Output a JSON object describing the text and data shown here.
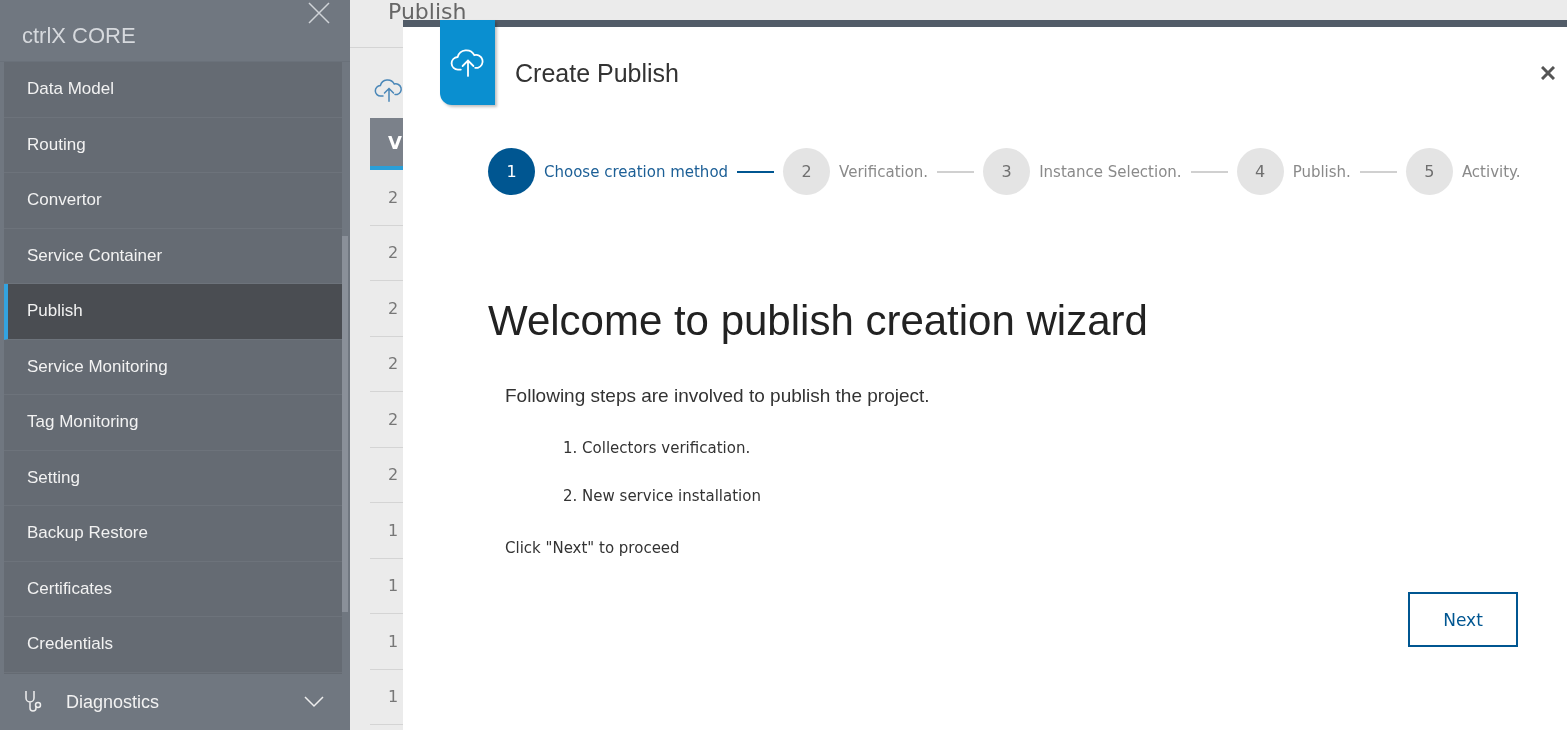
{
  "sidebar": {
    "title": "ctrlX CORE",
    "items": [
      {
        "label": "Data Model",
        "selected": false
      },
      {
        "label": "Routing",
        "selected": false
      },
      {
        "label": "Convertor",
        "selected": false
      },
      {
        "label": "Service Container",
        "selected": false
      },
      {
        "label": "Publish",
        "selected": true
      },
      {
        "label": "Service Monitoring",
        "selected": false
      },
      {
        "label": "Tag Monitoring",
        "selected": false
      },
      {
        "label": "Setting",
        "selected": false
      },
      {
        "label": "Backup Restore",
        "selected": false
      },
      {
        "label": "Certificates",
        "selected": false
      },
      {
        "label": "Credentials",
        "selected": false
      }
    ],
    "group": {
      "label": "Diagnostics",
      "expanded": false
    }
  },
  "page": {
    "title": "Publish",
    "table": {
      "column_1": "V",
      "rows": [
        "2",
        "2",
        "2",
        "2",
        "2",
        "2",
        "1",
        "1",
        "1",
        "1"
      ]
    }
  },
  "dialog": {
    "title": "Create Publish",
    "steps": [
      {
        "number": "1",
        "label": "Choose creation method",
        "selected": true
      },
      {
        "number": "2",
        "label": "Verification.",
        "selected": false
      },
      {
        "number": "3",
        "label": "Instance Selection.",
        "selected": false
      },
      {
        "number": "4",
        "label": "Publish.",
        "selected": false
      },
      {
        "number": "5",
        "label": "Activity.",
        "selected": false
      }
    ],
    "heading": "Welcome to publish creation wizard",
    "intro": "Following steps are involved to publish the project.",
    "list": [
      "1. Collectors verification.",
      "2. New service installation"
    ],
    "hint": "Click \"Next\" to proceed",
    "buttons": [
      "Next"
    ]
  }
}
